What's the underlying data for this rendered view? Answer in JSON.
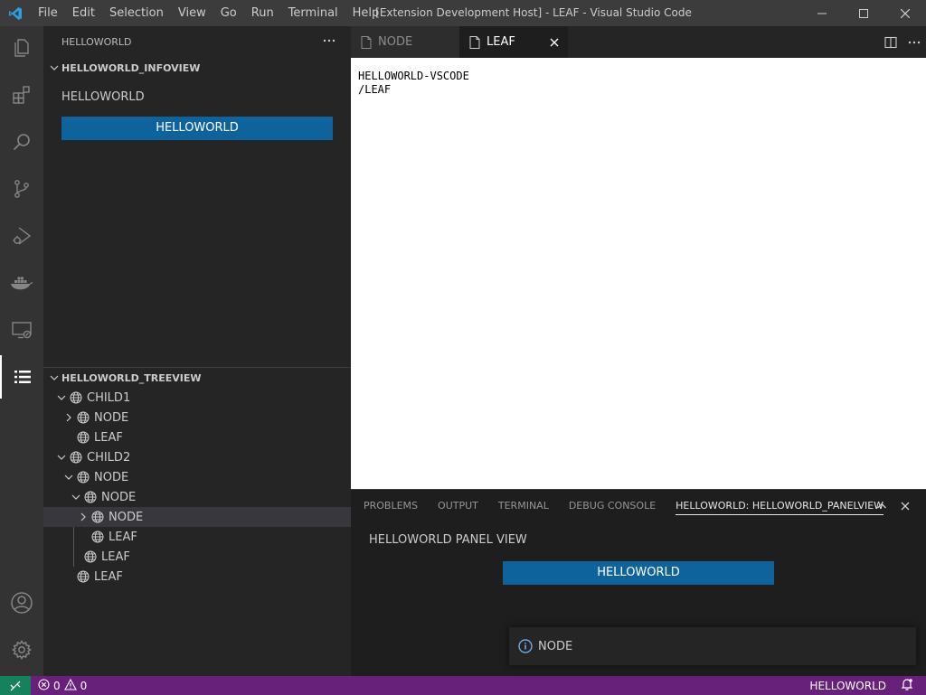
{
  "titlebar": {
    "menu": [
      "File",
      "Edit",
      "Selection",
      "View",
      "Go",
      "Run",
      "Terminal",
      "Help"
    ],
    "title": "[Extension Development Host] - LEAF - Visual Studio Code"
  },
  "activitybar": {
    "icons": [
      "explorer-icon",
      "extensions-icon",
      "search-icon",
      "source-control-icon",
      "run-debug-icon",
      "docker-icon",
      "remote-explorer-icon",
      "helloworld-list-icon",
      "accounts-icon",
      "manage-gear-icon"
    ]
  },
  "sidebar": {
    "header": "HELLOWORLD",
    "infoview": {
      "title": "HELLOWORLD_INFOVIEW",
      "text": "HELLOWORLD",
      "button": "HELLOWORLD"
    },
    "treeview": {
      "title": "HELLOWORLD_TREEVIEW",
      "rows": [
        {
          "label": "CHILD1",
          "twisty": "expanded",
          "depth": 0
        },
        {
          "label": "NODE",
          "twisty": "collapsed",
          "depth": 1
        },
        {
          "label": "LEAF",
          "twisty": "none",
          "depth": 1
        },
        {
          "label": "CHILD2",
          "twisty": "expanded",
          "depth": 0
        },
        {
          "label": "NODE",
          "twisty": "expanded",
          "depth": 1
        },
        {
          "label": "NODE",
          "twisty": "expanded",
          "depth": 2
        },
        {
          "label": "NODE",
          "twisty": "collapsed",
          "depth": 3,
          "selected": true
        },
        {
          "label": "LEAF",
          "twisty": "none",
          "depth": 3
        },
        {
          "label": "LEAF",
          "twisty": "none",
          "depth": 2
        },
        {
          "label": "LEAF",
          "twisty": "none",
          "depth": 1
        }
      ]
    }
  },
  "editor": {
    "tabs": [
      {
        "label": "NODE",
        "active": false
      },
      {
        "label": "LEAF",
        "active": true
      }
    ],
    "lines": [
      "HELLOWORLD-VSCODE",
      "/LEAF"
    ]
  },
  "panel": {
    "tabs": [
      "PROBLEMS",
      "OUTPUT",
      "TERMINAL",
      "DEBUG CONSOLE",
      "HELLOWORLD: HELLOWORLD_PANELVIEW"
    ],
    "active_tab": "HELLOWORLD: HELLOWORLD_PANELVIEW",
    "text": "HELLOWORLD PANEL VIEW",
    "button": "HELLOWORLD"
  },
  "notification": {
    "text": "NODE"
  },
  "statusbar": {
    "errors": "0",
    "warnings": "0",
    "right_text": "HELLOWORLD"
  },
  "colors": {
    "accent_button": "#0e639c",
    "statusbar": "#68217a",
    "remote": "#16825d"
  }
}
